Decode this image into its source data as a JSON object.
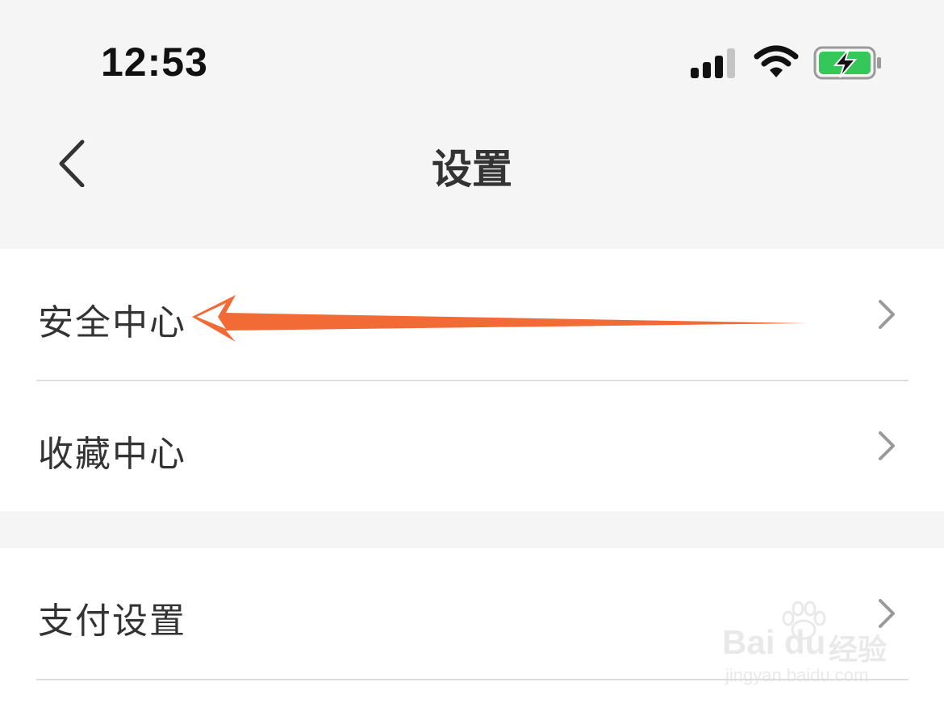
{
  "status_bar": {
    "time": "12:53",
    "signal_icon": "cellular-signal-icon",
    "wifi_icon": "wifi-icon",
    "battery_icon": "battery-charging-icon",
    "battery_color": "#34c759"
  },
  "nav": {
    "back_icon": "chevron-left-icon",
    "title": "设置"
  },
  "settings_groups": [
    {
      "items": [
        {
          "label": "安全中心",
          "icon": "chevron-right-icon"
        },
        {
          "label": "收藏中心",
          "icon": "chevron-right-icon"
        }
      ]
    },
    {
      "items": [
        {
          "label": "支付设置",
          "icon": "chevron-right-icon"
        }
      ]
    }
  ],
  "annotation": {
    "icon": "arrow-left-annotation",
    "color": "#f26a35"
  },
  "watermark": {
    "logo": "Bai du",
    "text": "经验",
    "url": "jingyan.baidu.com"
  },
  "colors": {
    "background": "#f5f5f5",
    "surface": "#ffffff",
    "divider": "#dddddd",
    "text": "#333333",
    "chevron": "#9a9a9a"
  }
}
